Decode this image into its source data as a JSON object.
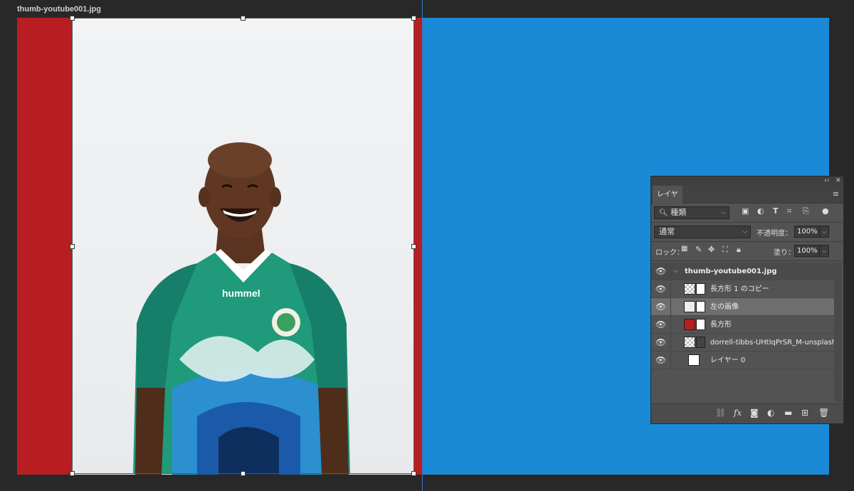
{
  "document": {
    "title": "thumb-youtube001.jpg"
  },
  "colors": {
    "red": "#b81e21",
    "blue": "#1a8ad6",
    "panel": "#535353"
  },
  "layers_panel": {
    "tab_label": "レイヤー",
    "filter": {
      "label": "種類"
    },
    "blend_mode": "通常",
    "opacity": {
      "label": "不透明度：",
      "value": "100%"
    },
    "lock": {
      "label": "ロック："
    },
    "fill": {
      "label": "塗り：",
      "value": "100%"
    },
    "layers": [
      {
        "name": "thumb-youtube001.jpg",
        "type": "group"
      },
      {
        "name": "長方形 1 のコピー",
        "type": "shape"
      },
      {
        "name": "左の画像",
        "type": "image",
        "selected": true
      },
      {
        "name": "長方形",
        "type": "shape-red"
      },
      {
        "name": "dorrell-tibbs-UHtIqPrSR_M-unsplash",
        "type": "smart"
      },
      {
        "name": "レイヤー 0",
        "type": "fill"
      }
    ]
  }
}
